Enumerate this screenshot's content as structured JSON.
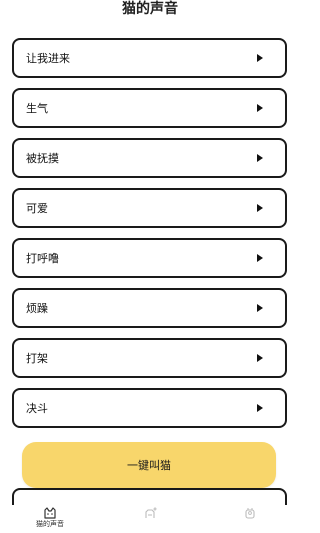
{
  "page": {
    "title": "猫的声音"
  },
  "sounds": [
    {
      "label": "让我进来"
    },
    {
      "label": "生气"
    },
    {
      "label": "被抚摸"
    },
    {
      "label": "可爱"
    },
    {
      "label": "打呼噜"
    },
    {
      "label": "烦躁"
    },
    {
      "label": "打架"
    },
    {
      "label": "决斗"
    }
  ],
  "cta": {
    "label": "一键叫猫"
  },
  "tabbar": {
    "tabs": [
      {
        "label": "猫的声音",
        "icon": "cat-icon",
        "active": true
      },
      {
        "label": "",
        "icon": "pet-icon",
        "active": false
      },
      {
        "label": "",
        "icon": "profile-icon",
        "active": false
      }
    ]
  }
}
